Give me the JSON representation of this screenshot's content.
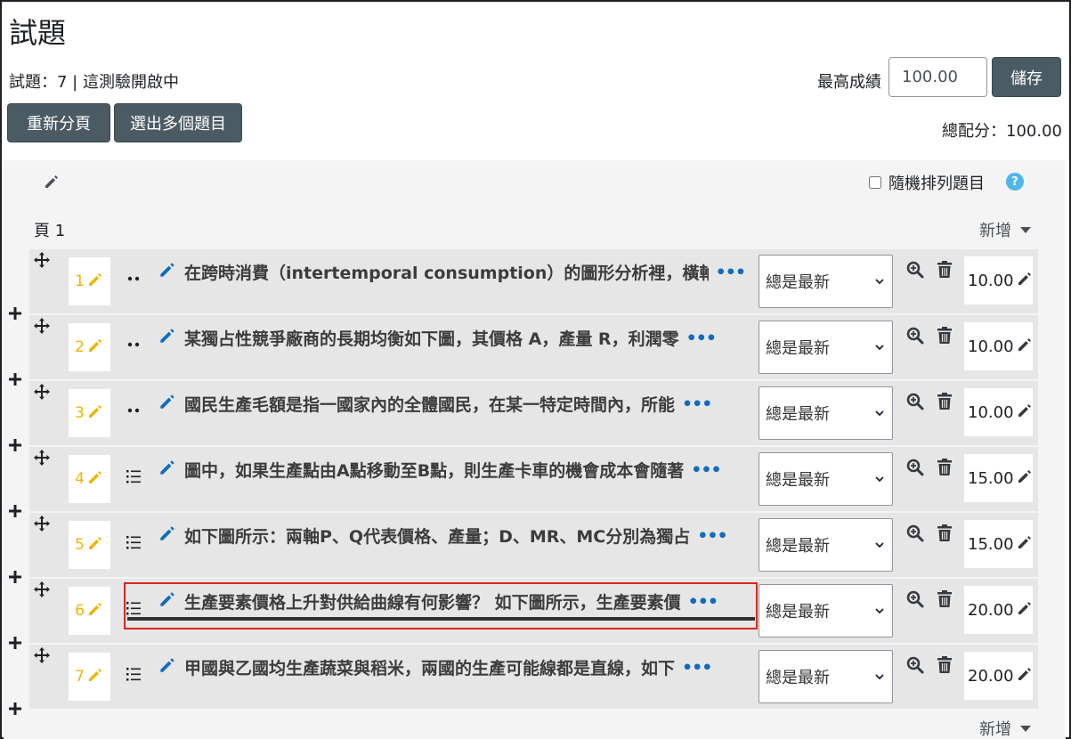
{
  "header": {
    "title": "試題",
    "status": "試題：7 | 這測驗開啟中",
    "max_grade_label": "最高成績",
    "max_grade_value": "100.00",
    "save_label": "儲存",
    "repaginate_label": "重新分頁",
    "select_multiple_label": "選出多個題目",
    "total_marks": "總配分：100.00"
  },
  "section": {
    "shuffle_label": "隨機排列題目",
    "page_label": "頁 1",
    "add_label": "新增",
    "add_bottom_label": "新增"
  },
  "questions": [
    {
      "number": "1",
      "type": "dots",
      "text": "在跨時消費（intertemporal consumption）的圖形分析裡，橫軸",
      "version": "總是最新",
      "mark": "10.00"
    },
    {
      "number": "2",
      "type": "dots",
      "text": "某獨占性競爭廠商的長期均衡如下圖，其價格 A，產量 R，利潤零",
      "version": "總是最新",
      "mark": "10.00"
    },
    {
      "number": "3",
      "type": "dots",
      "text": "國民生產毛額是指一國家內的全體國民，在某一特定時間內，所能",
      "version": "總是最新",
      "mark": "10.00"
    },
    {
      "number": "4",
      "type": "list",
      "text": "圖中，如果生產點由A點移動至B點，則生產卡車的機會成本會隨著",
      "version": "總是最新",
      "mark": "15.00"
    },
    {
      "number": "5",
      "type": "list",
      "text": "如下圖所示：兩軸P、Q代表價格、產量；D、MR、MC分別為獨占",
      "version": "總是最新",
      "mark": "15.00"
    },
    {
      "number": "6",
      "type": "list",
      "text": "生產要素價格上升對供給曲線有何影響？ 如下圖所示，生產要素價",
      "version": "總是最新",
      "mark": "20.00"
    },
    {
      "number": "7",
      "type": "list",
      "text": "甲國與乙國均生產蔬菜與稻米，兩國的生產可能線都是直線，如下",
      "version": "總是最新",
      "mark": "20.00"
    }
  ],
  "colors": {
    "button_bg": "#4b5b63",
    "link_blue": "#0f6cbf",
    "pencil_yellow": "#f0b400",
    "highlight_red": "#d9261c",
    "help_blue": "#4fb6e9"
  }
}
